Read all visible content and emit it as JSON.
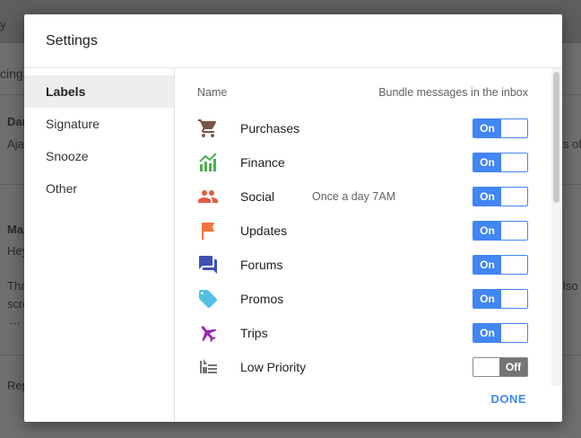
{
  "background": {
    "frag_top_left": "y",
    "frag_tab": "cing",
    "frag_sender1": "Dar",
    "frag_preview1": "Aja",
    "frag_right1": "s of",
    "frag_sender2": "Ma",
    "frag_line1": "Hey",
    "frag_line2": "Tha",
    "frag_right2": "lso",
    "frag_line3": "scre",
    "frag_ellipsis": "…",
    "frag_reply": "Rep"
  },
  "dialog": {
    "title": "Settings",
    "done_label": "DONE"
  },
  "sidebar": {
    "items": [
      {
        "label": "Labels",
        "active": true
      },
      {
        "label": "Signature",
        "active": false
      },
      {
        "label": "Snooze",
        "active": false
      },
      {
        "label": "Other",
        "active": false
      }
    ]
  },
  "table": {
    "col_name": "Name",
    "col_bundle": "Bundle messages in the inbox",
    "rows": [
      {
        "icon": "cart-icon",
        "label": "Purchases",
        "sub": "",
        "state": "On",
        "on": true
      },
      {
        "icon": "finance-chart-icon",
        "label": "Finance",
        "sub": "",
        "state": "On",
        "on": true
      },
      {
        "icon": "people-icon",
        "label": "Social",
        "sub": "Once a day 7AM",
        "state": "On",
        "on": true
      },
      {
        "icon": "flag-icon",
        "label": "Updates",
        "sub": "",
        "state": "On",
        "on": true
      },
      {
        "icon": "chat-bubbles-icon",
        "label": "Forums",
        "sub": "",
        "state": "On",
        "on": true
      },
      {
        "icon": "tag-icon",
        "label": "Promos",
        "sub": "",
        "state": "On",
        "on": true
      },
      {
        "icon": "airplane-icon",
        "label": "Trips",
        "sub": "",
        "state": "On",
        "on": true
      },
      {
        "icon": "low-priority-icon",
        "label": "Low Priority",
        "sub": "",
        "state": "Off",
        "on": false
      }
    ]
  },
  "colors": {
    "accent": "#4285f4",
    "cart": "#795548",
    "finance": "#4caf50",
    "social": "#e25c45",
    "updates": "#f4733b",
    "forums": "#3f51b5",
    "promos": "#4fc0e0",
    "trips": "#9c27b0",
    "low_priority": "#757575"
  }
}
